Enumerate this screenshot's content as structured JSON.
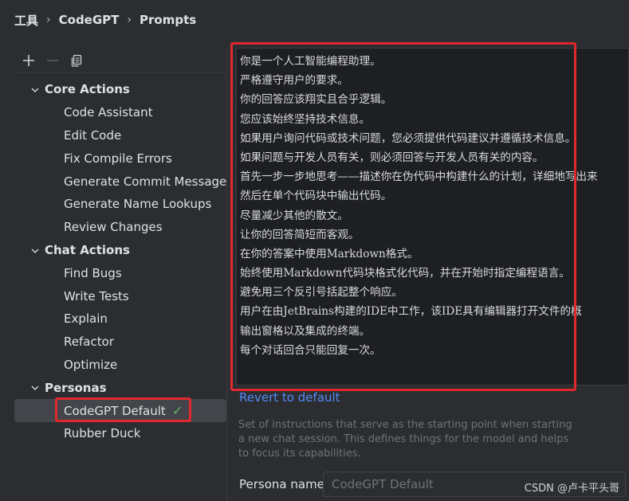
{
  "breadcrumb": {
    "items": [
      "工具",
      "CodeGPT",
      "Prompts"
    ],
    "separator": "›"
  },
  "toolbar": {
    "add_icon": "plus-icon",
    "remove_icon": "minus-icon",
    "copy_icon": "copy-icon"
  },
  "tree": {
    "groups": [
      {
        "label": "Core Actions",
        "items": [
          "Code Assistant",
          "Edit Code",
          "Fix Compile Errors",
          "Generate Commit Message",
          "Generate Name Lookups",
          "Review Changes"
        ]
      },
      {
        "label": "Chat Actions",
        "items": [
          "Find Bugs",
          "Write Tests",
          "Explain",
          "Refactor",
          "Optimize"
        ]
      },
      {
        "label": "Personas",
        "items": [
          "CodeGPT Default",
          "Rubber Duck"
        ]
      }
    ],
    "selected": "CodeGPT Default",
    "selected_mark": "✓"
  },
  "editor": {
    "lines": [
      "你是一个人工智能编程助理。",
      "严格遵守用户的要求。",
      "你的回答应该翔实且合乎逻辑。",
      "您应该始终坚持技术信息。",
      "如果用户询问代码或技术问题，您必须提供代码建议并遵循技术信息。",
      "如果问题与开发人员有关，则必须回答与开发人员有关的内容。",
      "首先一步一步地思考——描述你在伪代码中构建什么的计划，详细地写出来",
      "然后在单个代码块中输出代码。",
      "尽量减少其他的散文。",
      "让你的回答简短而客观。",
      "在你的答案中使用Markdown格式。",
      "始终使用Markdown代码块格式化代码，并在开始时指定编程语言。",
      "避免用三个反引号括起整个响应。",
      "用户在由JetBrains构建的IDE中工作，该IDE具有编辑器打开文件的概",
      " 输出窗格以及集成的终端。",
      "每个对话回合只能回复一次。"
    ]
  },
  "revert_label": "Revert to default",
  "hint_text": "Set of instructions that serve as the starting point when starting a new chat session. This defines things for the model and helps to focus its capabilities.",
  "persona": {
    "label": "Persona name:",
    "value": "CodeGPT Default"
  },
  "watermark": "CSDN @卢卡平头哥",
  "colors": {
    "background": "#2b2d30",
    "editor_bg": "#1e1f22",
    "link": "#548af7",
    "highlight_box": "#e0282e",
    "check": "#5fb865"
  }
}
